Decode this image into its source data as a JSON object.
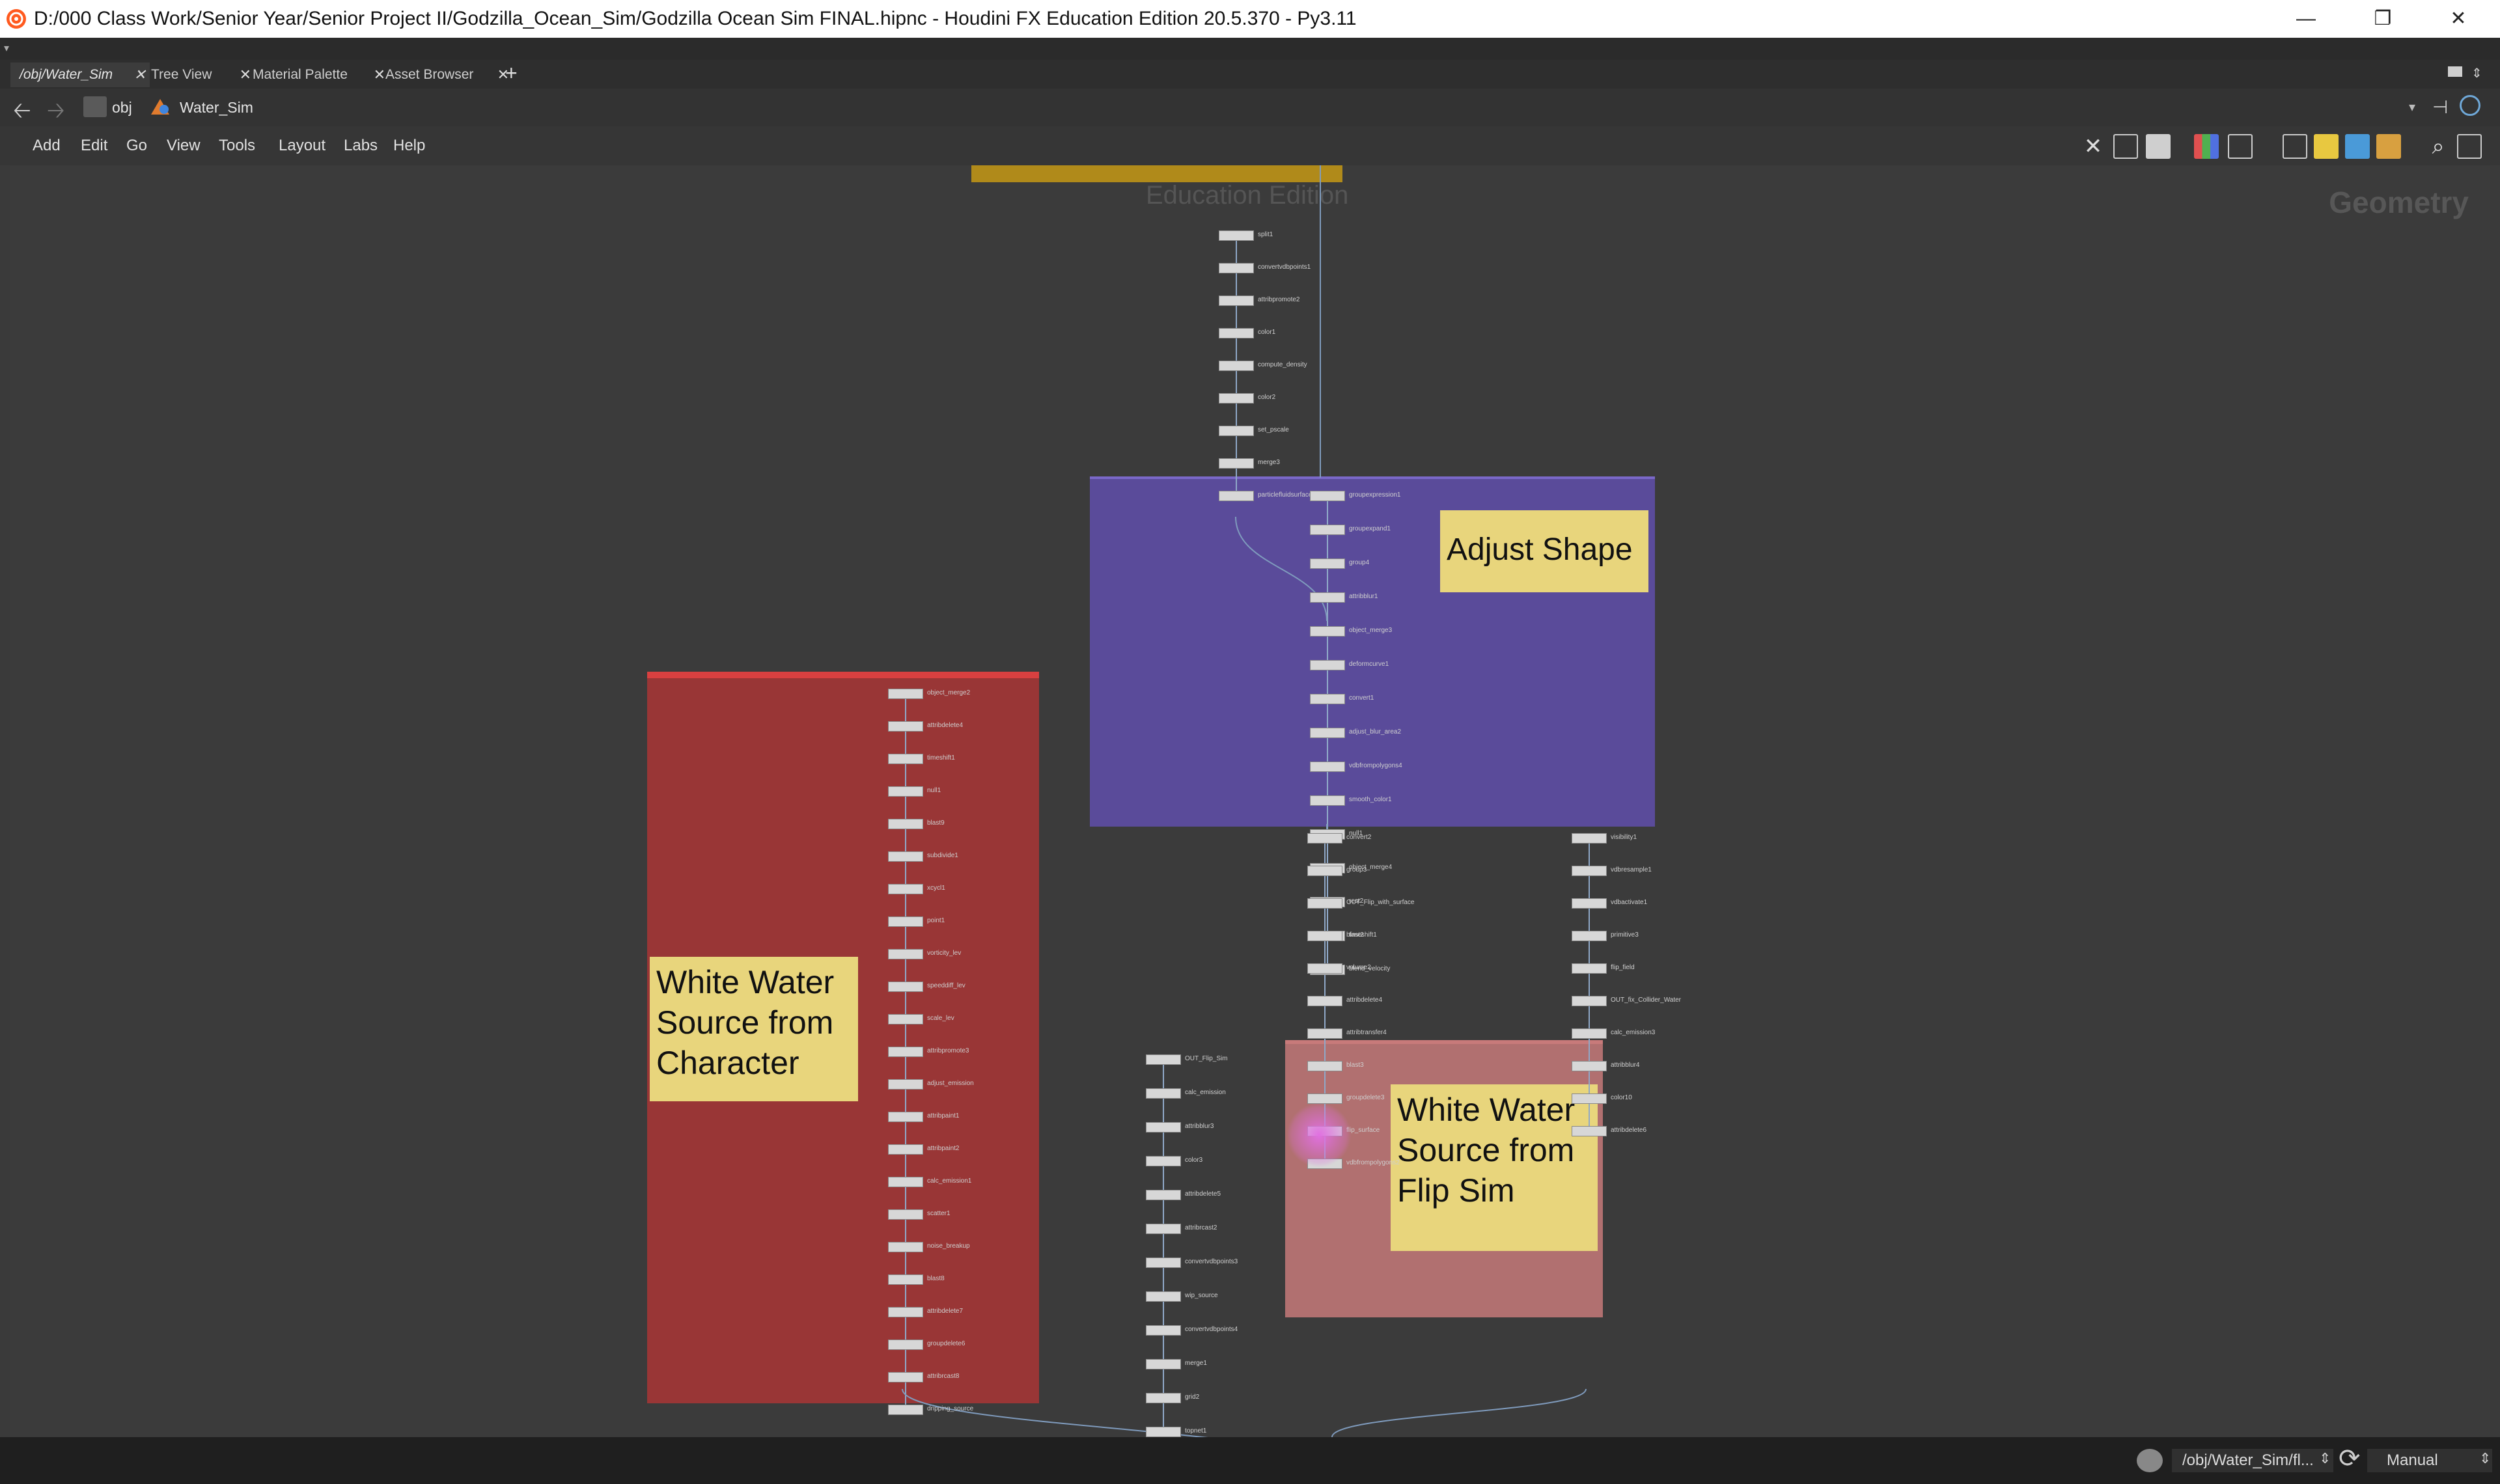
{
  "window": {
    "title": "D:/000 Class Work/Senior Year/Senior Project II/Godzilla_Ocean_Sim/Godzilla Ocean Sim FINAL.hipnc - Houdini FX Education Edition 20.5.370 - Py3.11",
    "minimize": "—",
    "maximize": "❐",
    "close": "✕"
  },
  "tabs": [
    {
      "label": "/obj/Water_Sim",
      "close": "✕"
    },
    {
      "label": "Tree View",
      "close": "✕"
    },
    {
      "label": "Material Palette",
      "close": "✕"
    },
    {
      "label": "Asset Browser",
      "close": "✕"
    }
  ],
  "tabs_add": "+",
  "path": {
    "root": "obj",
    "current": "Water_Sim",
    "back_icon": "arrow-left-icon",
    "forward_icon": "arrow-right-icon"
  },
  "menu": [
    "Add",
    "Edit",
    "Go",
    "View",
    "Tools",
    "Layout",
    "Labs",
    "Help"
  ],
  "network": {
    "watermark": "Education Edition",
    "context_label": "Geometry",
    "sticky_notes": [
      {
        "text": "Adjust Shape"
      },
      {
        "text": "White Water Source from Character"
      },
      {
        "text": "White Water Source from Flip Sim"
      }
    ],
    "nodes": [
      "split1",
      "convertvdbpoints1",
      "attribpromote2",
      "color1",
      "compute_density",
      "color2",
      "set_pscale",
      "merge3",
      "particlefluidsurface1",
      "groupexpression1",
      "groupexpand1",
      "group4",
      "attribblur1",
      "object_merge3",
      "deformcurve1",
      "convert1",
      "adjust_blur_area2",
      "vdbfrompolygons4",
      "smooth_color1",
      "null1",
      "object_merge4",
      "rest2",
      "timeshift1",
      "blend_velocity",
      "object_merge2",
      "attribdelete4",
      "timeshift1",
      "null1",
      "blast9",
      "subdivide1",
      "xcycl1",
      "point1",
      "vorticity_lev",
      "speeddiff_lev",
      "scale_lev",
      "attribpromote3",
      "adjust_emission",
      "attribpaint1",
      "attribpaint2",
      "calc_emission1",
      "scatter1",
      "noise_breakup",
      "blast8",
      "attribdelete7",
      "groupdelete6",
      "attribrcast8",
      "dripping_source",
      "convert2",
      "group3",
      "OUT_Flip_with_surface",
      "blast2",
      "volume2",
      "attribdelete4",
      "attribtransfer4",
      "blast3",
      "groupdelete3",
      "flip_surface",
      "vdbfrompolygons2",
      "visibility1",
      "vdbresample1",
      "vdbactivate1",
      "primitive3",
      "flip_field",
      "OUT_fix_Collider_Water",
      "calc_emission3",
      "attribblur4",
      "color10",
      "attribdelete6",
      "OUT_Flip_Sim",
      "calc_emission",
      "attribblur3",
      "color3",
      "attribdelete5",
      "attribrcast2",
      "convertvdbpoints3",
      "wip_source",
      "convertvdbpoints4",
      "merge1",
      "grid2",
      "topnet1"
    ]
  },
  "status": {
    "path": "/obj/Water_Sim/fl...",
    "mode": "Manual"
  }
}
